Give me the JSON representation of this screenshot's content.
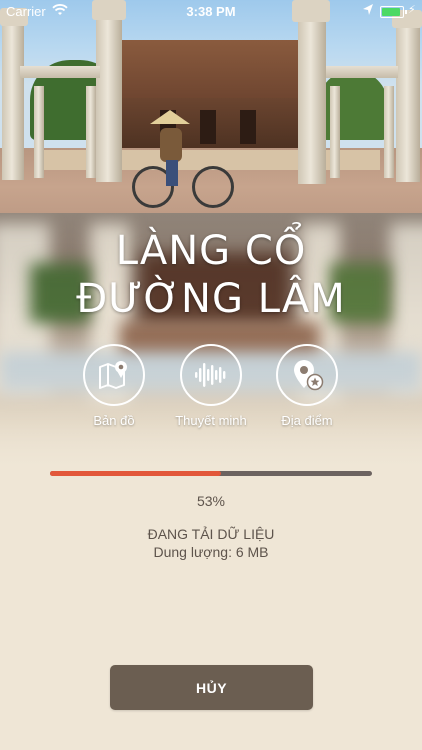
{
  "status_bar": {
    "carrier": "Carrier",
    "time": "3:38 PM",
    "battery_color": "#4cd964"
  },
  "title": {
    "line1": "LÀNG CỔ",
    "line2": "ĐƯỜNG LÂM"
  },
  "features": [
    {
      "label": "Bản đồ",
      "icon": "map-pin-icon"
    },
    {
      "label": "Thuyết minh",
      "icon": "audio-wave-icon"
    },
    {
      "label": "Địa điểm",
      "icon": "location-star-icon"
    }
  ],
  "download": {
    "progress": 0.53,
    "percent_text": "53%",
    "status_text": "ĐANG TẢI DỮ LIỆU",
    "size_text": "Dung lượng: 6 MB",
    "progress_color": "#e2573a",
    "track_color": "#6c6360"
  },
  "cancel_button": {
    "label": "HỦY",
    "color": "#6b5e51"
  }
}
